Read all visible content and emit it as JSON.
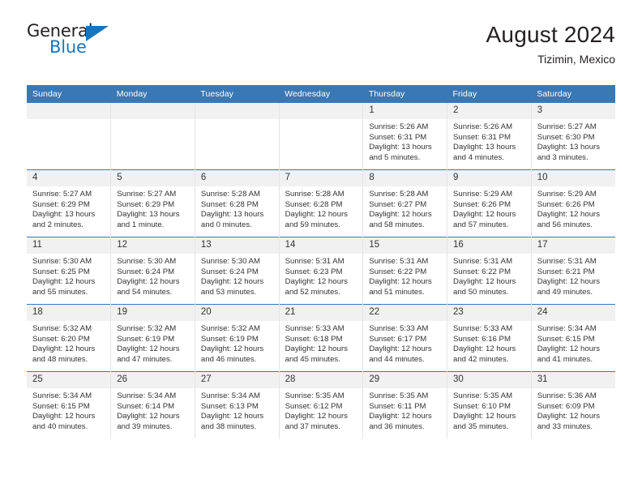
{
  "brand": {
    "name_top": "General",
    "name_bottom": "Blue",
    "accent_color": "#1b75bb"
  },
  "header": {
    "title": "August 2024",
    "subtitle": "Tizimin, Mexico"
  },
  "calendar": {
    "header_bg": "#3a77b5",
    "daynum_bg": "#f1f1f1",
    "weekday_headers": [
      "Sunday",
      "Monday",
      "Tuesday",
      "Wednesday",
      "Thursday",
      "Friday",
      "Saturday"
    ],
    "weeks": [
      [
        {
          "day": "",
          "sunrise": "",
          "sunset": "",
          "daylight1": "",
          "daylight2": ""
        },
        {
          "day": "",
          "sunrise": "",
          "sunset": "",
          "daylight1": "",
          "daylight2": ""
        },
        {
          "day": "",
          "sunrise": "",
          "sunset": "",
          "daylight1": "",
          "daylight2": ""
        },
        {
          "day": "",
          "sunrise": "",
          "sunset": "",
          "daylight1": "",
          "daylight2": ""
        },
        {
          "day": "1",
          "sunrise": "Sunrise: 5:26 AM",
          "sunset": "Sunset: 6:31 PM",
          "daylight1": "Daylight: 13 hours",
          "daylight2": "and 5 minutes."
        },
        {
          "day": "2",
          "sunrise": "Sunrise: 5:26 AM",
          "sunset": "Sunset: 6:31 PM",
          "daylight1": "Daylight: 13 hours",
          "daylight2": "and 4 minutes."
        },
        {
          "day": "3",
          "sunrise": "Sunrise: 5:27 AM",
          "sunset": "Sunset: 6:30 PM",
          "daylight1": "Daylight: 13 hours",
          "daylight2": "and 3 minutes."
        }
      ],
      [
        {
          "day": "4",
          "sunrise": "Sunrise: 5:27 AM",
          "sunset": "Sunset: 6:29 PM",
          "daylight1": "Daylight: 13 hours",
          "daylight2": "and 2 minutes."
        },
        {
          "day": "5",
          "sunrise": "Sunrise: 5:27 AM",
          "sunset": "Sunset: 6:29 PM",
          "daylight1": "Daylight: 13 hours",
          "daylight2": "and 1 minute."
        },
        {
          "day": "6",
          "sunrise": "Sunrise: 5:28 AM",
          "sunset": "Sunset: 6:28 PM",
          "daylight1": "Daylight: 13 hours",
          "daylight2": "and 0 minutes."
        },
        {
          "day": "7",
          "sunrise": "Sunrise: 5:28 AM",
          "sunset": "Sunset: 6:28 PM",
          "daylight1": "Daylight: 12 hours",
          "daylight2": "and 59 minutes."
        },
        {
          "day": "8",
          "sunrise": "Sunrise: 5:28 AM",
          "sunset": "Sunset: 6:27 PM",
          "daylight1": "Daylight: 12 hours",
          "daylight2": "and 58 minutes."
        },
        {
          "day": "9",
          "sunrise": "Sunrise: 5:29 AM",
          "sunset": "Sunset: 6:26 PM",
          "daylight1": "Daylight: 12 hours",
          "daylight2": "and 57 minutes."
        },
        {
          "day": "10",
          "sunrise": "Sunrise: 5:29 AM",
          "sunset": "Sunset: 6:26 PM",
          "daylight1": "Daylight: 12 hours",
          "daylight2": "and 56 minutes."
        }
      ],
      [
        {
          "day": "11",
          "sunrise": "Sunrise: 5:30 AM",
          "sunset": "Sunset: 6:25 PM",
          "daylight1": "Daylight: 12 hours",
          "daylight2": "and 55 minutes."
        },
        {
          "day": "12",
          "sunrise": "Sunrise: 5:30 AM",
          "sunset": "Sunset: 6:24 PM",
          "daylight1": "Daylight: 12 hours",
          "daylight2": "and 54 minutes."
        },
        {
          "day": "13",
          "sunrise": "Sunrise: 5:30 AM",
          "sunset": "Sunset: 6:24 PM",
          "daylight1": "Daylight: 12 hours",
          "daylight2": "and 53 minutes."
        },
        {
          "day": "14",
          "sunrise": "Sunrise: 5:31 AM",
          "sunset": "Sunset: 6:23 PM",
          "daylight1": "Daylight: 12 hours",
          "daylight2": "and 52 minutes."
        },
        {
          "day": "15",
          "sunrise": "Sunrise: 5:31 AM",
          "sunset": "Sunset: 6:22 PM",
          "daylight1": "Daylight: 12 hours",
          "daylight2": "and 51 minutes."
        },
        {
          "day": "16",
          "sunrise": "Sunrise: 5:31 AM",
          "sunset": "Sunset: 6:22 PM",
          "daylight1": "Daylight: 12 hours",
          "daylight2": "and 50 minutes."
        },
        {
          "day": "17",
          "sunrise": "Sunrise: 5:31 AM",
          "sunset": "Sunset: 6:21 PM",
          "daylight1": "Daylight: 12 hours",
          "daylight2": "and 49 minutes."
        }
      ],
      [
        {
          "day": "18",
          "sunrise": "Sunrise: 5:32 AM",
          "sunset": "Sunset: 6:20 PM",
          "daylight1": "Daylight: 12 hours",
          "daylight2": "and 48 minutes."
        },
        {
          "day": "19",
          "sunrise": "Sunrise: 5:32 AM",
          "sunset": "Sunset: 6:19 PM",
          "daylight1": "Daylight: 12 hours",
          "daylight2": "and 47 minutes."
        },
        {
          "day": "20",
          "sunrise": "Sunrise: 5:32 AM",
          "sunset": "Sunset: 6:19 PM",
          "daylight1": "Daylight: 12 hours",
          "daylight2": "and 46 minutes."
        },
        {
          "day": "21",
          "sunrise": "Sunrise: 5:33 AM",
          "sunset": "Sunset: 6:18 PM",
          "daylight1": "Daylight: 12 hours",
          "daylight2": "and 45 minutes."
        },
        {
          "day": "22",
          "sunrise": "Sunrise: 5:33 AM",
          "sunset": "Sunset: 6:17 PM",
          "daylight1": "Daylight: 12 hours",
          "daylight2": "and 44 minutes."
        },
        {
          "day": "23",
          "sunrise": "Sunrise: 5:33 AM",
          "sunset": "Sunset: 6:16 PM",
          "daylight1": "Daylight: 12 hours",
          "daylight2": "and 42 minutes."
        },
        {
          "day": "24",
          "sunrise": "Sunrise: 5:34 AM",
          "sunset": "Sunset: 6:15 PM",
          "daylight1": "Daylight: 12 hours",
          "daylight2": "and 41 minutes."
        }
      ],
      [
        {
          "day": "25",
          "sunrise": "Sunrise: 5:34 AM",
          "sunset": "Sunset: 6:15 PM",
          "daylight1": "Daylight: 12 hours",
          "daylight2": "and 40 minutes."
        },
        {
          "day": "26",
          "sunrise": "Sunrise: 5:34 AM",
          "sunset": "Sunset: 6:14 PM",
          "daylight1": "Daylight: 12 hours",
          "daylight2": "and 39 minutes."
        },
        {
          "day": "27",
          "sunrise": "Sunrise: 5:34 AM",
          "sunset": "Sunset: 6:13 PM",
          "daylight1": "Daylight: 12 hours",
          "daylight2": "and 38 minutes."
        },
        {
          "day": "28",
          "sunrise": "Sunrise: 5:35 AM",
          "sunset": "Sunset: 6:12 PM",
          "daylight1": "Daylight: 12 hours",
          "daylight2": "and 37 minutes."
        },
        {
          "day": "29",
          "sunrise": "Sunrise: 5:35 AM",
          "sunset": "Sunset: 6:11 PM",
          "daylight1": "Daylight: 12 hours",
          "daylight2": "and 36 minutes."
        },
        {
          "day": "30",
          "sunrise": "Sunrise: 5:35 AM",
          "sunset": "Sunset: 6:10 PM",
          "daylight1": "Daylight: 12 hours",
          "daylight2": "and 35 minutes."
        },
        {
          "day": "31",
          "sunrise": "Sunrise: 5:36 AM",
          "sunset": "Sunset: 6:09 PM",
          "daylight1": "Daylight: 12 hours",
          "daylight2": "and 33 minutes."
        }
      ]
    ]
  }
}
